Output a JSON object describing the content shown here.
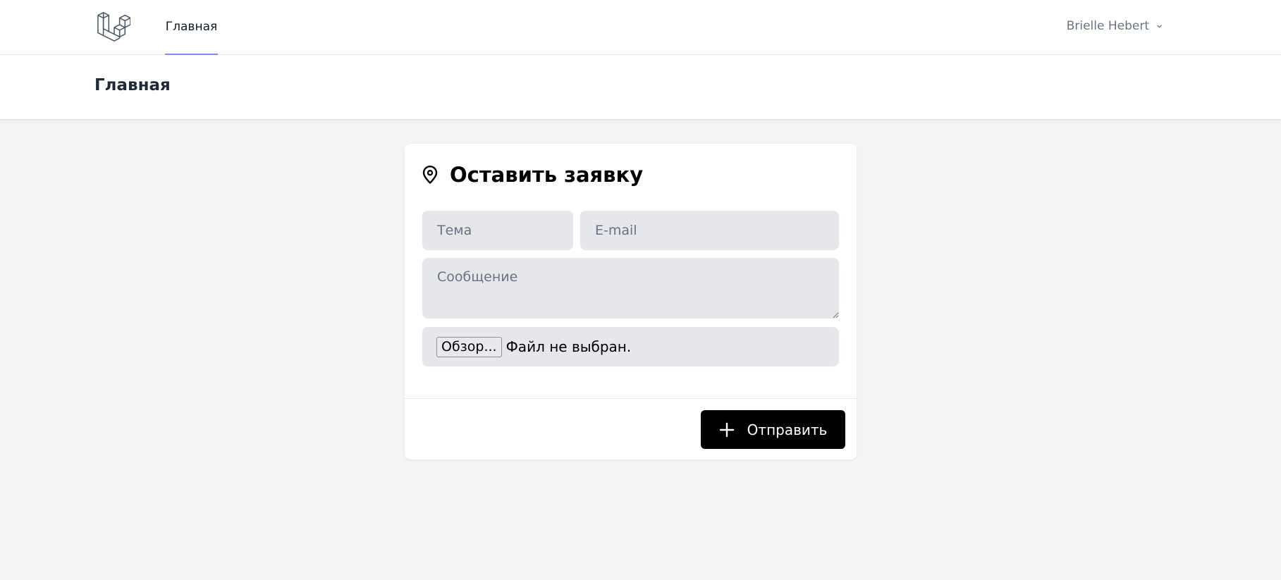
{
  "nav": {
    "logo_icon": "laravel-logo-icon",
    "links": [
      {
        "label": "Главная",
        "active": true
      }
    ],
    "user_name": "Brielle Hebert",
    "user_menu_icon": "chevron-down-icon"
  },
  "header": {
    "title": "Главная"
  },
  "form": {
    "title": "Оставить заявку",
    "title_icon": "location-pin-icon",
    "topic_placeholder": "Тема",
    "email_placeholder": "E-mail",
    "message_placeholder": "Сообщение",
    "file_button": "Обзор...",
    "file_status": "Файл не выбран.",
    "submit_label": "Отправить",
    "submit_icon": "plus-icon"
  },
  "colors": {
    "page_background": "#f3f4f6",
    "active_tab_underline": "#818cf8",
    "input_background": "#e5e7eb",
    "submit_background": "#000000"
  }
}
